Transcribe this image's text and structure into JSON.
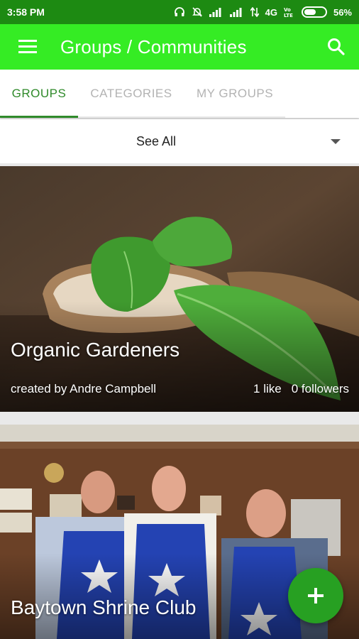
{
  "status_bar": {
    "time": "3:58 PM",
    "network": "4G",
    "battery": "56%",
    "battery_level": 0.56,
    "icons": [
      "headphones-icon",
      "mute-icon",
      "signal-icon",
      "signal-icon",
      "data-arrows-icon",
      "volte-icon",
      "battery-icon"
    ]
  },
  "app_bar": {
    "title": "Groups / Communities",
    "menu_icon": "hamburger-menu-icon",
    "search_icon": "search-icon",
    "background": "#35ec24"
  },
  "tabs": [
    {
      "label": "GROUPS",
      "active": true
    },
    {
      "label": "CATEGORIES",
      "active": false
    },
    {
      "label": "MY GROUPS",
      "active": false
    }
  ],
  "filter": {
    "selected": "See All",
    "icon": "dropdown-arrow-icon"
  },
  "groups": [
    {
      "title": "Organic Gardeners",
      "creator": "created by Andre Campbell",
      "likes": "1 like",
      "followers": "0 followers"
    },
    {
      "title": "Baytown Shrine Club"
    }
  ],
  "fab": {
    "icon": "plus-icon",
    "color": "#27a022"
  },
  "colors": {
    "status_bar": "#1d8a12",
    "accent": "#2f8a2a",
    "tab_inactive": "#b3b3b3"
  }
}
